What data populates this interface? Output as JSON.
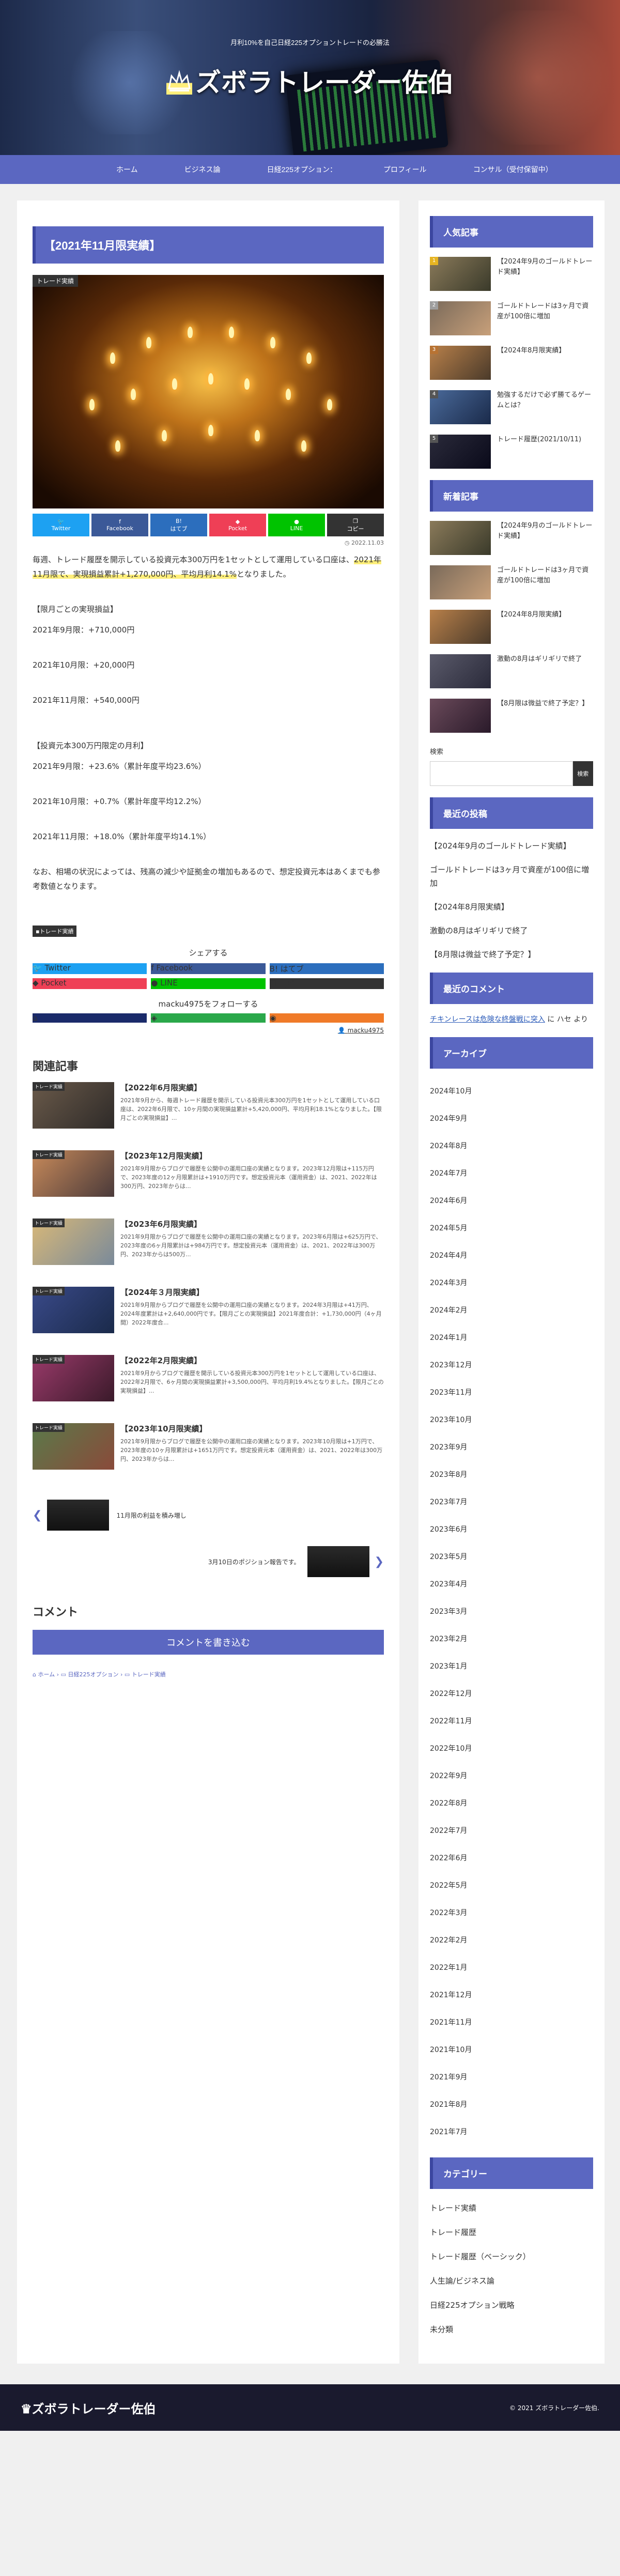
{
  "site": {
    "tagline": "月利10%を自己日経225オプショントレードの必勝法",
    "title": "ズボラトレーダー佐伯"
  },
  "nav": [
    {
      "label": "ホーム"
    },
    {
      "label": "ビジネス論"
    },
    {
      "label": "日経225オプション："
    },
    {
      "label": "プロフィール"
    },
    {
      "label": "コンサル（受付保留中）"
    }
  ],
  "article": {
    "title": "【2021年11月限実績】",
    "category": "トレード実績",
    "date": "2022.11.03",
    "share_small": [
      {
        "label": "Twitter",
        "color": "#1da1f2"
      },
      {
        "label": "Facebook",
        "color": "#3b5998"
      },
      {
        "label": "はてブ",
        "color": "#2c6ebd"
      },
      {
        "label": "Pocket",
        "color": "#ef3f56"
      },
      {
        "label": "LINE",
        "color": "#00c300"
      },
      {
        "label": "コピー",
        "color": "#333333"
      }
    ],
    "intro_before": "毎週、トレード履歴を開示している投資元本300万円を1セットとして運用している口座は、",
    "intro_mark": "2021年11月限で、実現損益累計+1,270,000円、平均月利14.1%",
    "intro_after": "となりました。",
    "sec1_title": "【限月ごとの実現損益】",
    "sec1_items": [
      "2021年9月限：+710,000円",
      "2021年10月限：+20,000円",
      "2021年11月限：+540,000円"
    ],
    "sec2_title": "【投資元本300万円限定の月利】",
    "sec2_items": [
      "2021年9月限：+23.6%（累計年度平均23.6%）",
      "2021年10月限：+0.7%（累計年度平均12.2%）",
      "2021年11月限：+18.0%（累計年度平均14.1%）"
    ],
    "note": "なお、相場の状況によっては、残高の減少や証拠金の増加もあるので、想定投資元本はあくまでも参考数値となります。",
    "tag": "トレード実績"
  },
  "share": {
    "head": "シェアする",
    "buttons": [
      {
        "label": "Twitter",
        "color": "#1da1f2"
      },
      {
        "label": "Facebook",
        "color": "#3b5998"
      },
      {
        "label": "はてブ",
        "color": "#2c6ebd"
      },
      {
        "label": "Pocket",
        "color": "#ef3f56"
      },
      {
        "label": "LINE",
        "color": "#00c300"
      },
      {
        "label": "コピー",
        "color": "#333333"
      }
    ]
  },
  "follow": {
    "head": "macku4975をフォローする",
    "author": "macku4975"
  },
  "related": {
    "heading": "関連記事",
    "items": [
      {
        "cat": "トレード実績",
        "title": "【2022年6月限実績】",
        "excerpt": "2021年9月から、毎週トレード履歴を開示している投資元本300万円を1セットとして運用している口座は、2022年6月限で、10ヶ月間の実現損益累計+5,420,000円、平均月利18.1%となりました。【限月ごとの実現損益】...",
        "c1": "#6a5a4a",
        "c2": "#2e2a28"
      },
      {
        "cat": "トレード実績",
        "title": "【2023年12月限実績】",
        "excerpt": "2021年9月限からブログで履歴を公開中の運用口座の実績となります。2023年12月限は+115万円で、2023年度の12ヶ月限累計は+1910万円です。想定投資元本（運用資金）は、2021、2022年は300万円、2023年からは...",
        "c1": "#c88a5a",
        "c2": "#4a3a3a"
      },
      {
        "cat": "トレード実績",
        "title": "【2023年6月限実績】",
        "excerpt": "2021年9月限からブログで履歴を公開中の運用口座の実績となります。2023年6月限は+625万円で、2023年度の6ヶ月限累計は+984万円です。想定投資元本（運用資金）は、2021、2022年は300万円、2023年からは500万...",
        "c1": "#d8b878",
        "c2": "#7a8a9a"
      },
      {
        "cat": "トレード実績",
        "title": "【2024年３月限実績】",
        "excerpt": "2021年9月限からブログで履歴を公開中の運用口座の実績となります。2024年3月限は+41万円、2024年度累計は+2,640,000円です。【限月ごとの実現損益】2021年度合計：+1,730,000円（4ヶ月間）2022年度合...",
        "c1": "#3a4a8a",
        "c2": "#1a2a4a"
      },
      {
        "cat": "トレード実績",
        "title": "【2022年2月限実績】",
        "excerpt": "2021年9月からブログで履歴を開示している投資元本300万円を1セットとして運用している口座は、2022年2月限で、6ヶ月間の実現損益累計+3,500,000円、平均月利19.4%となりました。【限月ごとの実現損益】...",
        "c1": "#9a3a6a",
        "c2": "#3a1a2a"
      },
      {
        "cat": "トレード実績",
        "title": "【2023年10月限実績】",
        "excerpt": "2021年9月限からブログで履歴を公開中の運用口座の実績となります。2023年10月限は+1万円で、2023年度の10ヶ月限累計は+1651万円です。想定投資元本（運用資金）は、2021、2022年は300万円、2023年からは...",
        "c1": "#5a7a4a",
        "c2": "#8a4a3a"
      }
    ]
  },
  "pager": {
    "prev": "11月限の利益を積み増し",
    "next": "3月10日のポジション報告です。"
  },
  "comment": {
    "heading": "コメント",
    "button": "コメントを書き込む"
  },
  "breadcrumb": [
    "ホーム",
    "日経225オプション",
    "トレード実績"
  ],
  "sidebar": {
    "popular_title": "人気記事",
    "popular": [
      {
        "num": "1",
        "title": "【2024年9月のゴールドトレード実績】",
        "c": "#8a7a5a",
        "badge": "#e6b422"
      },
      {
        "num": "2",
        "title": "ゴールドトレードは3ヶ月で資産が100倍に増加",
        "c": "#7a6a5a",
        "badge": "#9e9e9e"
      },
      {
        "num": "3",
        "title": "【2024年8月限実績】",
        "c": "#b8804a",
        "badge": "#b87333"
      },
      {
        "num": "4",
        "title": "勉強するだけで必ず勝てるゲームとは？",
        "c": "#4a6a9a",
        "badge": "#555555"
      },
      {
        "num": "5",
        "title": "トレード履歴(2021/10/11)",
        "c": "#2a2a3a",
        "badge": "#555555"
      }
    ],
    "new_title": "新着記事",
    "new": [
      {
        "title": "【2024年9月のゴールドトレード実績】",
        "c": "#8a7a5a"
      },
      {
        "title": "ゴールドトレードは3ヶ月で資産が100倍に増加",
        "c": "#7a6a5a"
      },
      {
        "title": "【2024年8月限実績】",
        "c": "#b8804a"
      },
      {
        "title": "激動の8月はギリギリで終了",
        "c": "#5a5a6a"
      },
      {
        "title": "【8月限は微益で終了予定？】",
        "c": "#6a4a5a"
      }
    ],
    "search_label": "検索",
    "search_button": "検索",
    "recent_title": "最近の投稿",
    "recent": [
      "【2024年9月のゴールドトレード実績】",
      "ゴールドトレードは3ヶ月で資産が100倍に増加",
      "【2024年8月限実績】",
      "激動の8月はギリギリで終了",
      "【8月限は微益で終了予定？】"
    ],
    "comments_title": "最近のコメント",
    "comment_link": "チキンレースは危険な終盤戦に突入",
    "comment_rest": " に ハセ より",
    "archive_title": "アーカイブ",
    "archives": [
      "2024年10月",
      "2024年9月",
      "2024年8月",
      "2024年7月",
      "2024年6月",
      "2024年5月",
      "2024年4月",
      "2024年3月",
      "2024年2月",
      "2024年1月",
      "2023年12月",
      "2023年11月",
      "2023年10月",
      "2023年9月",
      "2023年8月",
      "2023年7月",
      "2023年6月",
      "2023年5月",
      "2023年4月",
      "2023年3月",
      "2023年2月",
      "2023年1月",
      "2022年12月",
      "2022年11月",
      "2022年10月",
      "2022年9月",
      "2022年8月",
      "2022年7月",
      "2022年6月",
      "2022年5月",
      "2022年3月",
      "2022年2月",
      "2022年1月",
      "2021年12月",
      "2021年11月",
      "2021年10月",
      "2021年9月",
      "2021年8月",
      "2021年7月"
    ],
    "category_title": "カテゴリー",
    "categories": [
      "トレード実績",
      "トレード履歴",
      "トレード履歴（ベーシック）",
      "人生論/ビジネス論",
      "日経225オプション戦略",
      "未分類"
    ]
  },
  "footer": {
    "logo": "ズボラトレーダー佐伯",
    "copyright": "© 2021 ズボラトレーダー佐伯."
  }
}
